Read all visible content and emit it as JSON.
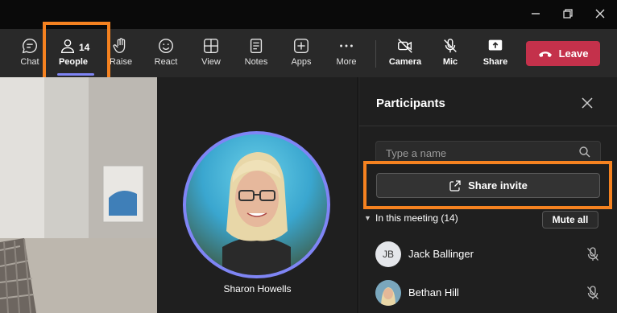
{
  "toolbar": {
    "chat_label": "Chat",
    "people_label": "People",
    "people_count": "14",
    "raise_label": "Raise",
    "react_label": "React",
    "view_label": "View",
    "notes_label": "Notes",
    "apps_label": "Apps",
    "more_label": "More",
    "camera_label": "Camera",
    "mic_label": "Mic",
    "share_label": "Share",
    "leave_label": "Leave"
  },
  "stage": {
    "speaker_name": "Sharon Howells"
  },
  "panel": {
    "title": "Participants",
    "search_placeholder": "Type a name",
    "share_invite_label": "Share invite",
    "section_label": "In this meeting (14)",
    "mute_all_label": "Mute all",
    "participants": [
      {
        "initials": "JB",
        "name": "Jack Ballinger"
      },
      {
        "initials": "",
        "name": "Bethan Hill"
      }
    ]
  },
  "colors": {
    "accent": "#7f85f5",
    "leave": "#c4314b",
    "highlight": "#f58220"
  }
}
